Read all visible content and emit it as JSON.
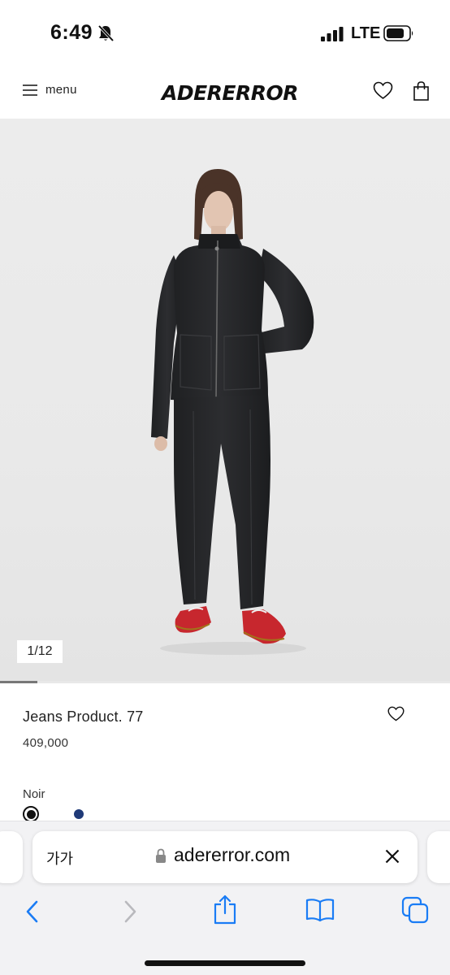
{
  "status_bar": {
    "time": "6:49",
    "network": "LTE",
    "icons": [
      "bell-slash-icon",
      "signal-icon",
      "battery-icon"
    ]
  },
  "header": {
    "menu_label": "menu",
    "logo": "ADERERROR",
    "icons": [
      "hamburger-icon",
      "heart-icon",
      "shopping-bag-icon"
    ]
  },
  "gallery": {
    "counter": "1/12",
    "progress": 0.083
  },
  "product": {
    "name": "Jeans Product. 77",
    "price": "409,000",
    "color_label": "Noir",
    "swatches": [
      {
        "color": "#111111",
        "selected": true
      },
      {
        "color": "#1f3a78",
        "selected": false
      }
    ]
  },
  "browser": {
    "text_size": "가가",
    "url": "adererror.com",
    "toolbar_icons": [
      "back-icon",
      "forward-icon",
      "share-icon",
      "bookmarks-icon",
      "tabs-icon"
    ]
  },
  "colors": {
    "accent": "#1a1a1a",
    "ios_blue": "#1a7cf5",
    "sneaker_red": "#c7272e",
    "denim": "#262729"
  }
}
